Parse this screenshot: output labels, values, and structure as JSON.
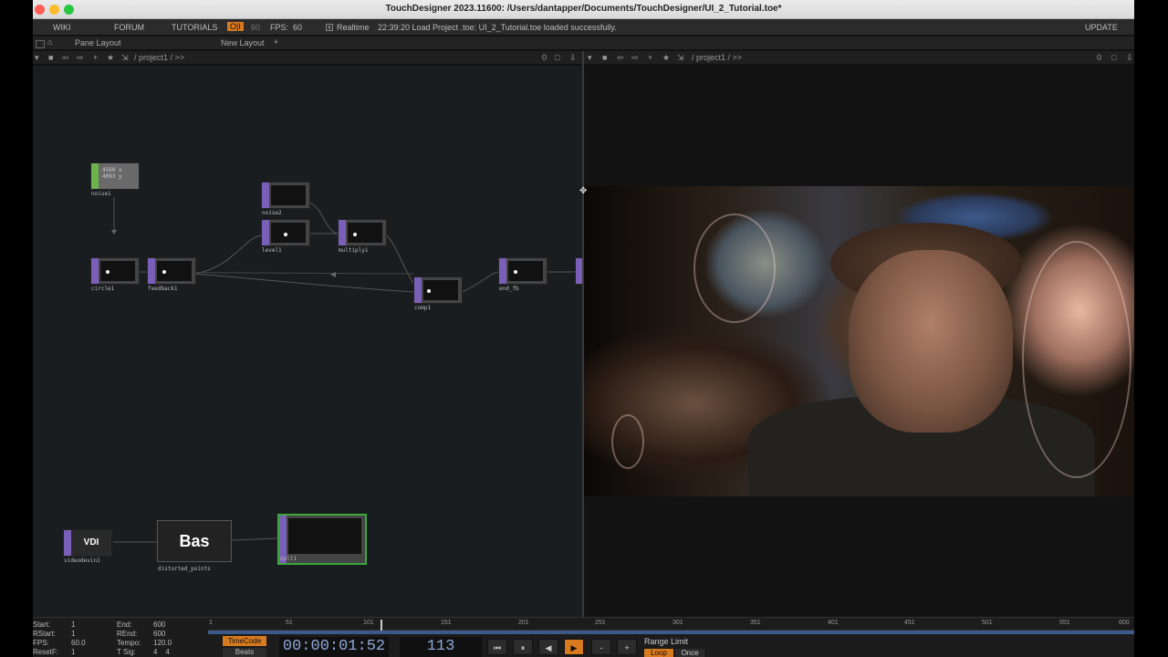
{
  "window": {
    "title": "TouchDesigner 2023.11600: /Users/dantapper/Documents/TouchDesigner/UI_2_Tutorial.toe*"
  },
  "menubar": {
    "wiki": "WIKI",
    "forum": "FORUM",
    "tutorials": "TUTORIALS",
    "oi": "O|I",
    "fps_num": "60",
    "fps_label": "FPS:",
    "fps_value": "60",
    "x_mark": "x",
    "realtime": "Realtime",
    "status": "22:39:20 Load Project .toe: UI_2_Tutorial.toe loaded successfully.",
    "update": "UPDATE"
  },
  "panebar": {
    "pane_layout": "Pane Layout",
    "new_layout": "New Layout",
    "plus": "+"
  },
  "left_path": {
    "path": "/ project1 / >>",
    "count": "0"
  },
  "right_path": {
    "path": "/ project1 / >>",
    "count": "0"
  },
  "nodes": {
    "noise1": "noise1",
    "noise1_values": "4560 x\n4093 y",
    "noise2": "noise2",
    "level1": "level1",
    "multiply1": "multiply1",
    "circle1": "circle1",
    "feedback1": "feedback1",
    "comp1": "comp1",
    "end_fb": "end_fb",
    "videodevin1": "videodevin1",
    "videodevin1_text": "VDI",
    "distorted_points": "distorted_points",
    "distorted_points_text": "Bas",
    "null1": "null1"
  },
  "timeline": {
    "start_label": "Start:",
    "start": "1",
    "rstart_label": "RStart:",
    "rstart": "1",
    "fps_label": "FPS:",
    "fps": "60.0",
    "resetf_label": "ResetF:",
    "resetf": "1",
    "end_label": "End:",
    "end": "600",
    "rend_label": "REnd:",
    "rend": "600",
    "tempo_label": "Tempo:",
    "tempo": "120.0",
    "tsig_label": "T Sig:",
    "tsig": "4    4",
    "ruler": [
      "1",
      "51",
      "101",
      "151",
      "201",
      "251",
      "301",
      "351",
      "401",
      "451",
      "501",
      "551",
      "600"
    ],
    "timecode_label": "TimeCode",
    "beats_label": "Beats",
    "timecode": "00:00:01:52",
    "frame": "113",
    "range_limit": "Range Limit",
    "loop": "Loop",
    "once": "Once",
    "btn_start": "⏮",
    "btn_pause": "⏸",
    "btn_back": "◀",
    "btn_play": "▶",
    "btn_minus": "-",
    "btn_plus": "+"
  },
  "colors": {
    "accent": "#d87a1e",
    "top_operator": "#7a5fb8",
    "chop_operator": "#6bb34a"
  }
}
